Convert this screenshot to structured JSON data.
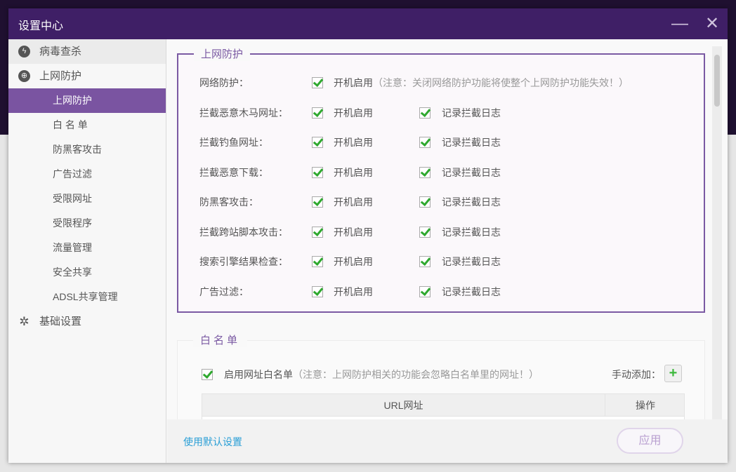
{
  "window": {
    "title": "设置中心",
    "minimize": "—",
    "close": "✕"
  },
  "sidebar": {
    "groups": [
      {
        "label": "病毒查杀",
        "icon": "lightning-icon"
      },
      {
        "label": "上网防护",
        "icon": "globe-icon"
      },
      {
        "label": "基础设置",
        "icon": "gear-icon"
      }
    ],
    "sub_items": [
      "上网防护",
      "白 名 单",
      "防黑客攻击",
      "广告过滤",
      "受限网址",
      "受限程序",
      "流量管理",
      "安全共享",
      "ADSL共享管理"
    ]
  },
  "protection": {
    "legend": "上网防护",
    "rows": [
      {
        "label": "网络防护：",
        "opt1": "开机启用",
        "note": "（注意：关闭网络防护功能将使整个上网防护功能失效！）",
        "checked1": true
      },
      {
        "label": "拦截恶意木马网址：",
        "opt1": "开机启用",
        "opt2": "记录拦截日志",
        "checked1": true,
        "checked2": true
      },
      {
        "label": "拦截钓鱼网址：",
        "opt1": "开机启用",
        "opt2": "记录拦截日志",
        "checked1": true,
        "checked2": true
      },
      {
        "label": "拦截恶意下载：",
        "opt1": "开机启用",
        "opt2": "记录拦截日志",
        "checked1": true,
        "checked2": true
      },
      {
        "label": "防黑客攻击：",
        "opt1": "开机启用",
        "opt2": "记录拦截日志",
        "checked1": true,
        "checked2": true
      },
      {
        "label": "拦截跨站脚本攻击：",
        "opt1": "开机启用",
        "opt2": "记录拦截日志",
        "checked1": true,
        "checked2": true
      },
      {
        "label": "搜索引擎结果检查：",
        "opt1": "开机启用",
        "opt2": "记录拦截日志",
        "checked1": true,
        "checked2": true
      },
      {
        "label": "广告过滤：",
        "opt1": "开机启用",
        "opt2": "记录拦截日志",
        "checked1": true,
        "checked2": true
      }
    ]
  },
  "whitelist": {
    "legend": "白名单",
    "enable_label": "启用网址白名单",
    "note": "（注意：上网防护相关的功能会忽略白名单里的网址！）",
    "manual_add": "手动添加：",
    "add": "+",
    "columns": [
      "URL网址",
      "操作"
    ]
  },
  "footer": {
    "default_link": "使用默认设置",
    "apply": "应用"
  },
  "colors": {
    "titlebar": "#3f1f66",
    "accent": "#7b5aa3",
    "selected": "#7a54a1",
    "check": "#2fa82f",
    "link": "#2a9fd6"
  }
}
